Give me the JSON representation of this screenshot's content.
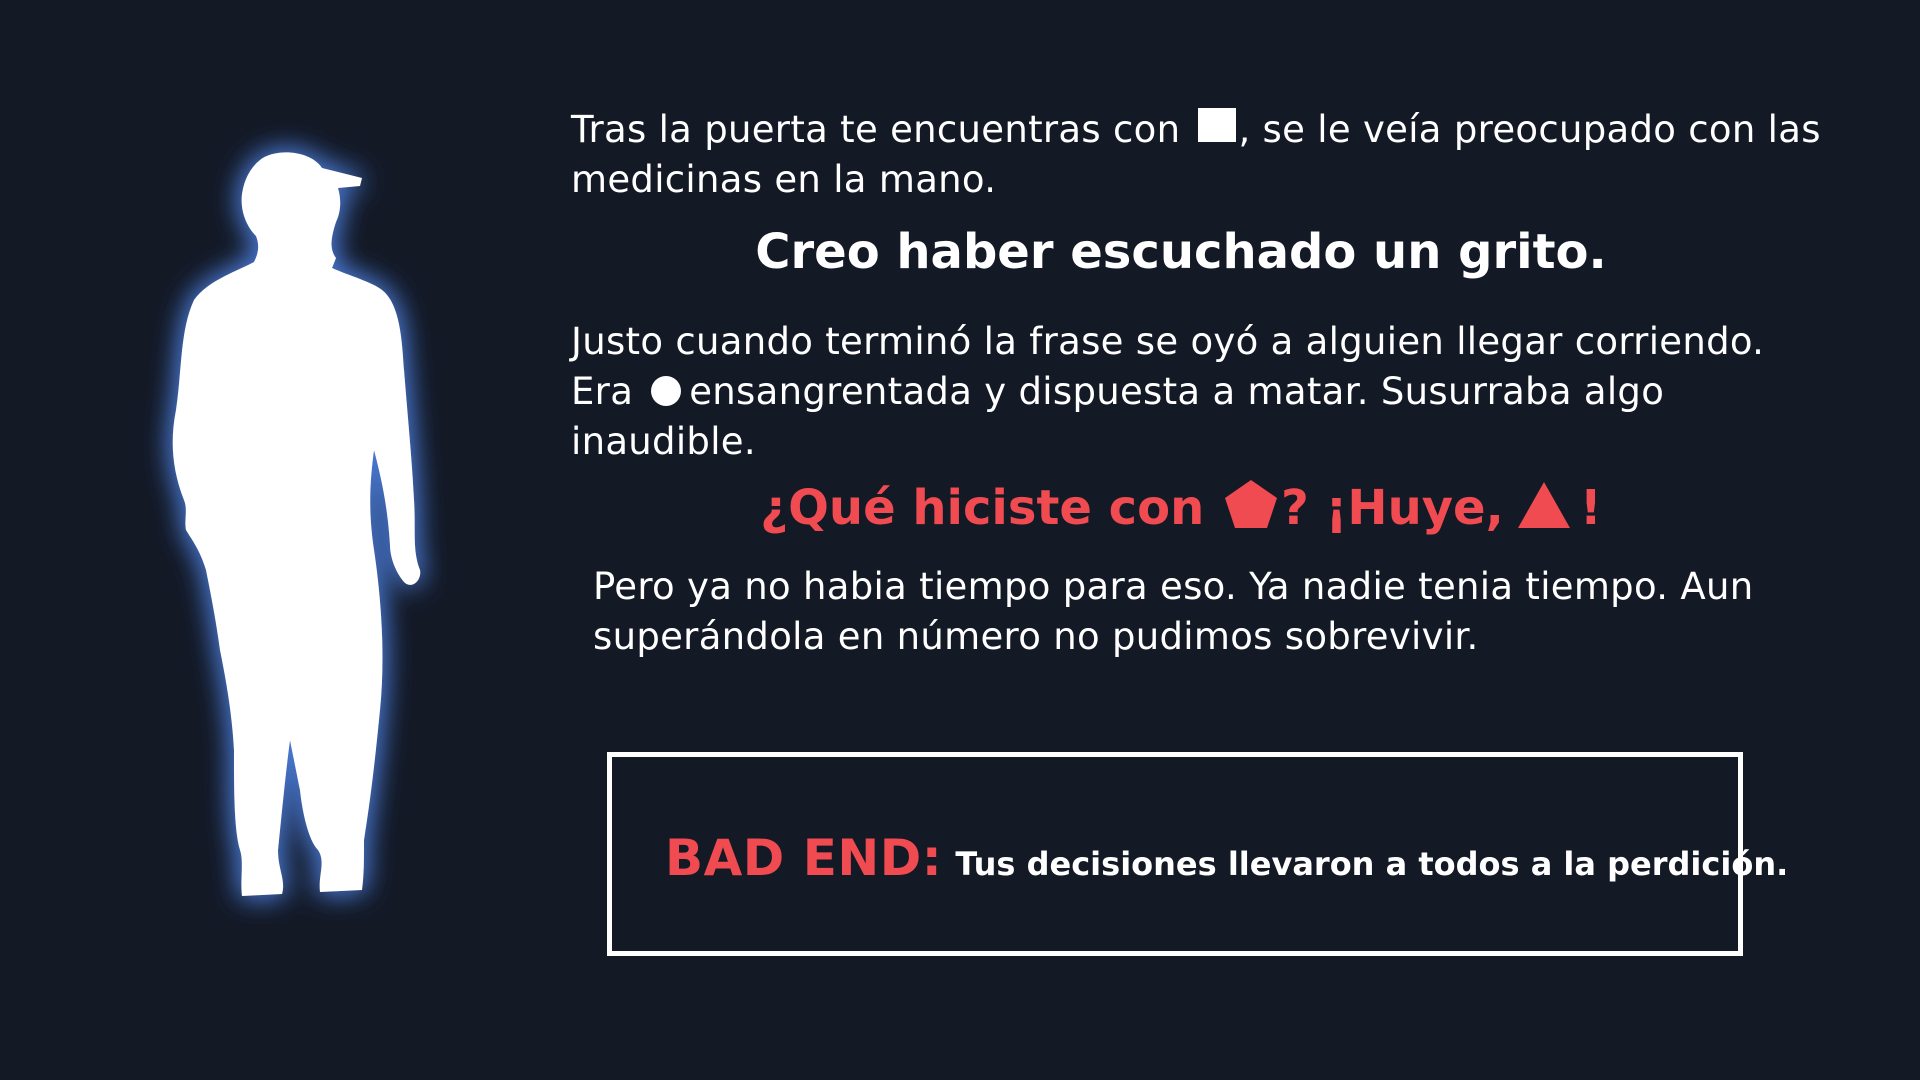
{
  "story": {
    "p1_before": "Tras la puerta te encuentras con",
    "p1_after": ", se le veía preocupado con las medicinas en la mano.",
    "headline1": "Creo haber escuchado un grito.",
    "p2_before": "Justo cuando terminó la frase se oyó a alguien llegar corriendo. Era",
    "p2_after": "ensangrentada y dispuesta a matar. Susurraba algo inaudible.",
    "headline2_part1": "¿Qué hiciste con",
    "headline2_part2": "? ¡Huye,",
    "headline2_part3": "!",
    "p3": "Pero ya no habia tiempo para eso. Ya nadie tenia tiempo. Aun superándola en número no pudimos sobrevivir."
  },
  "ending": {
    "label": "BAD END:",
    "text": "Tus decisiones llevaron a todos a la perdición."
  },
  "icons": {
    "square": "white-square-icon",
    "circle": "white-circle-icon",
    "pentagon": "red-pentagon-icon",
    "triangle": "red-triangle-icon",
    "figure": "glowing-man-silhouette"
  },
  "colors": {
    "background": "#141926",
    "accent_red": "#ef4b51",
    "text": "#ffffff",
    "glow": "#4a7bd6"
  }
}
